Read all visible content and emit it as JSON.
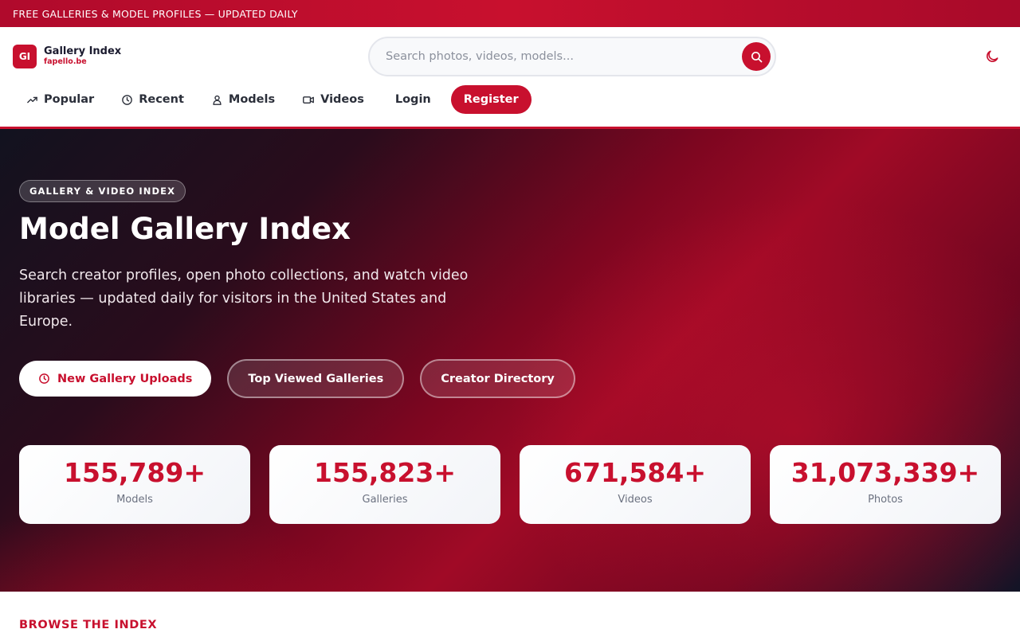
{
  "topbar": {
    "text": "FREE GALLERIES & MODEL PROFILES — UPDATED DAILY"
  },
  "brand": {
    "logo": "GI",
    "name": "Gallery Index",
    "domain": "fapello.be"
  },
  "search": {
    "placeholder": "Search photos, videos, models...",
    "value": "",
    "icon": "search-icon"
  },
  "theme_toggle": {
    "icon": "moon-icon"
  },
  "nav": {
    "items": [
      {
        "label": "Popular",
        "icon": "trending-up-icon"
      },
      {
        "label": "Recent",
        "icon": "clock-icon"
      },
      {
        "label": "Models",
        "icon": "user-icon"
      },
      {
        "label": "Videos",
        "icon": "video-icon"
      }
    ],
    "login": "Login",
    "register": "Register"
  },
  "hero": {
    "badge": "GALLERY & VIDEO INDEX",
    "title": "Model Gallery Index",
    "description": "Search creator profiles, open photo collections, and watch video libraries — updated daily for visitors in the United States and Europe.",
    "actions": [
      {
        "label": "New Gallery Uploads",
        "icon": "clock-icon",
        "style": "primary"
      },
      {
        "label": "Top Viewed Galleries",
        "style": "ghost"
      },
      {
        "label": "Creator Directory",
        "style": "ghost"
      }
    ]
  },
  "stats": [
    {
      "value": "155,789+",
      "label": "Models"
    },
    {
      "value": "155,823+",
      "label": "Galleries"
    },
    {
      "value": "671,584+",
      "label": "Videos"
    },
    {
      "value": "31,073,339+",
      "label": "Photos"
    }
  ],
  "browse": {
    "title": "BROWSE THE INDEX"
  },
  "colors": {
    "accent": "#c8102e",
    "text_dark": "#1a1a2e",
    "muted": "#6b7180"
  }
}
